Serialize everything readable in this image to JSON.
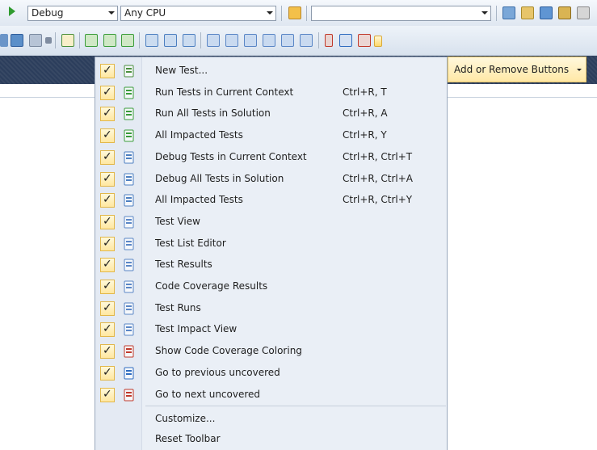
{
  "toolbar": {
    "config_combo": "Debug",
    "platform_combo": "Any CPU",
    "search_combo": ""
  },
  "submenu_button": "Add or Remove Buttons",
  "menu": {
    "items": [
      {
        "label": "New Test...",
        "shortcut": "",
        "icon": "new-test-icon",
        "color": "#4a8f3c"
      },
      {
        "label": "Run Tests in Current Context",
        "shortcut": "Ctrl+R, T",
        "icon": "run-tests-context-icon",
        "color": "#3a9c3a"
      },
      {
        "label": "Run All Tests in Solution",
        "shortcut": "Ctrl+R, A",
        "icon": "run-all-tests-icon",
        "color": "#3a9c3a"
      },
      {
        "label": "All Impacted Tests",
        "shortcut": "Ctrl+R, Y",
        "icon": "run-impacted-tests-icon",
        "color": "#3a9c3a"
      },
      {
        "label": "Debug Tests in Current Context",
        "shortcut": "Ctrl+R, Ctrl+T",
        "icon": "debug-tests-context-icon",
        "color": "#4c7fc0"
      },
      {
        "label": "Debug All Tests in Solution",
        "shortcut": "Ctrl+R, Ctrl+A",
        "icon": "debug-all-tests-icon",
        "color": "#4c7fc0"
      },
      {
        "label": "All Impacted Tests",
        "shortcut": "Ctrl+R, Ctrl+Y",
        "icon": "debug-impacted-tests-icon",
        "color": "#4c7fc0"
      },
      {
        "label": "Test View",
        "shortcut": "",
        "icon": "test-view-icon",
        "color": "#5a86c6"
      },
      {
        "label": "Test List Editor",
        "shortcut": "",
        "icon": "test-list-editor-icon",
        "color": "#5a86c6"
      },
      {
        "label": "Test Results",
        "shortcut": "",
        "icon": "test-results-icon",
        "color": "#5a86c6"
      },
      {
        "label": "Code Coverage Results",
        "shortcut": "",
        "icon": "code-coverage-results-icon",
        "color": "#5a86c6"
      },
      {
        "label": "Test Runs",
        "shortcut": "",
        "icon": "test-runs-icon",
        "color": "#5a86c6"
      },
      {
        "label": "Test Impact View",
        "shortcut": "",
        "icon": "test-impact-view-icon",
        "color": "#5a86c6"
      },
      {
        "label": "Show Code Coverage Coloring",
        "shortcut": "",
        "icon": "coverage-coloring-icon",
        "color": "#c0392b"
      },
      {
        "label": "Go to previous uncovered",
        "shortcut": "",
        "icon": "previous-uncovered-icon",
        "color": "#2f6cc0"
      },
      {
        "label": "Go to next uncovered",
        "shortcut": "",
        "icon": "next-uncovered-icon",
        "color": "#c0392b"
      }
    ],
    "bottom": [
      "Customize...",
      "Reset Toolbar"
    ]
  }
}
